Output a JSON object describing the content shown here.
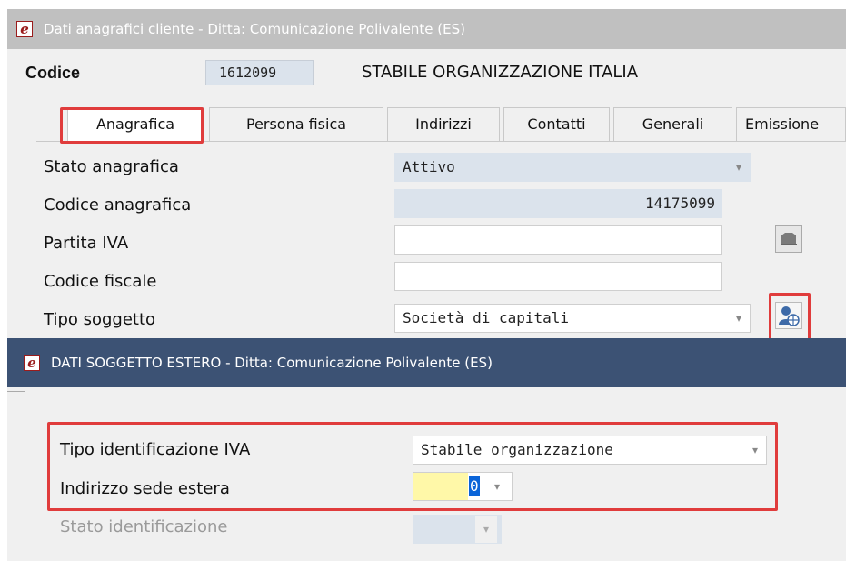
{
  "window": {
    "title": "Dati anagrafici cliente - Ditta: Comunicazione Polivalente (ES)",
    "app_icon": "e-icon"
  },
  "header": {
    "codice_label": "Codice",
    "codice_value": "1612099",
    "ragione_sociale": "STABILE ORGANIZZAZIONE ITALIA"
  },
  "tabs": [
    {
      "label": "Anagrafica",
      "active": true
    },
    {
      "label": "Persona fisica",
      "active": false
    },
    {
      "label": "Indirizzi",
      "active": false
    },
    {
      "label": "Contatti",
      "active": false
    },
    {
      "label": "Generali",
      "active": false
    },
    {
      "label": "Emissione",
      "active": false
    }
  ],
  "form": {
    "stato_anagrafica": {
      "label": "Stato anagrafica",
      "value": "Attivo"
    },
    "codice_anagrafica": {
      "label": "Codice anagrafica",
      "value": "14175099"
    },
    "partita_iva": {
      "label": "Partita IVA",
      "value": ""
    },
    "codice_fiscale": {
      "label": "Codice fiscale",
      "value": ""
    },
    "tipo_soggetto": {
      "label": "Tipo soggetto",
      "value": "Società di capitali"
    }
  },
  "dialog": {
    "title": "DATI SOGGETTO ESTERO - Ditta: Comunicazione Polivalente (ES)",
    "tipo_identificazione": {
      "label": "Tipo identificazione IVA",
      "value": "Stabile organizzazione"
    },
    "indirizzo_sede": {
      "label": "Indirizzo sede estera",
      "value": "0"
    },
    "stato_identificazione": {
      "label": "Stato identificazione",
      "value": ""
    }
  },
  "colors": {
    "highlight": "#e03c3c",
    "dialog_title": "#3c5274",
    "readonly_field": "#dbe3ec",
    "selection": "#0a64d8",
    "yellow_field": "#fff8a8"
  }
}
